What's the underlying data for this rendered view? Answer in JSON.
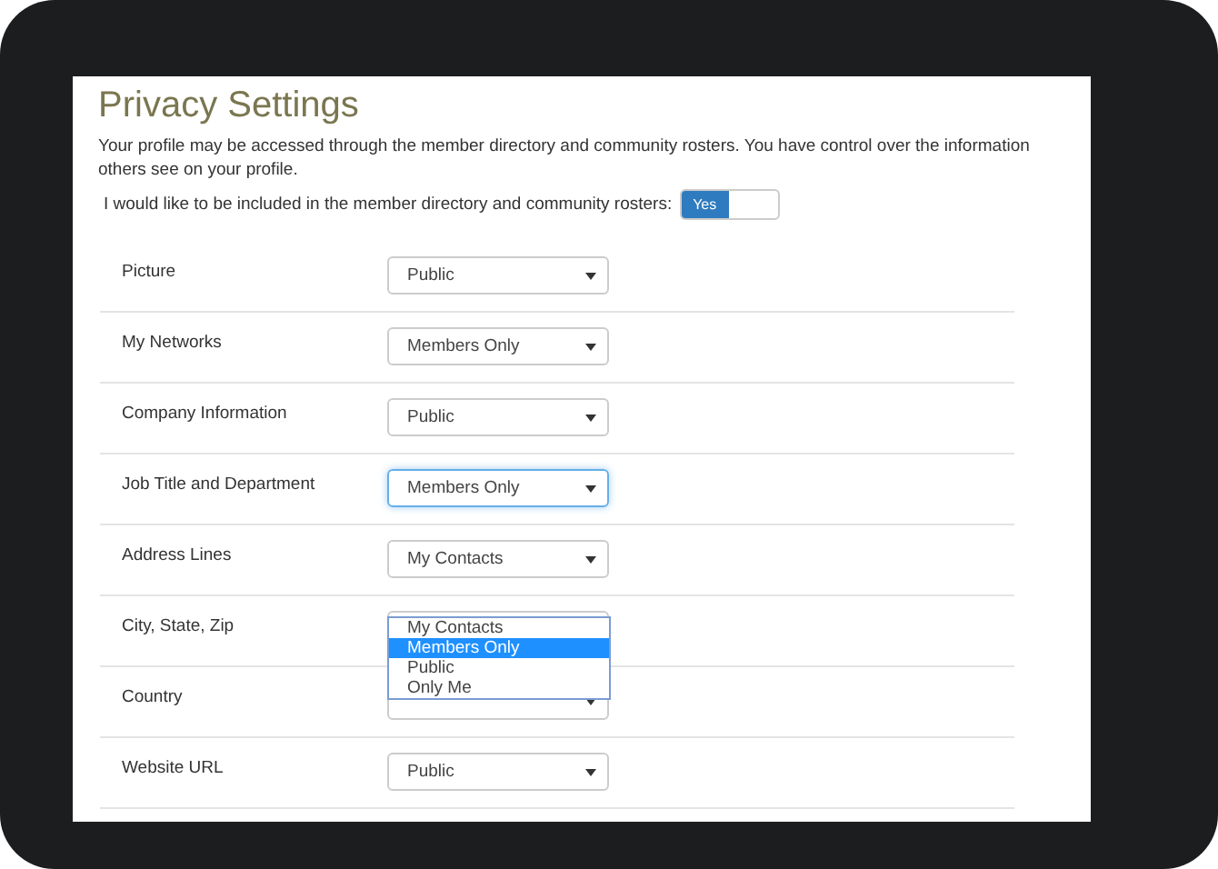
{
  "title": "Privacy Settings",
  "intro": "Your profile may be accessed through the member directory and community rosters. You have control over the information others see on your profile.",
  "directory_toggle": {
    "label": "I would like to be included in the member directory and community rosters:",
    "text": "Yes",
    "on": true
  },
  "settings": [
    {
      "label": "Picture",
      "value": "Public",
      "focused": false
    },
    {
      "label": "My Networks",
      "value": "Members Only",
      "focused": false
    },
    {
      "label": "Company Information",
      "value": "Public",
      "focused": false
    },
    {
      "label": "Job Title and Department",
      "value": "Members Only",
      "focused": true
    },
    {
      "label": "Address Lines",
      "value": "My Contacts",
      "focused": false
    },
    {
      "label": "City, State, Zip",
      "focused": false,
      "dropdown": [
        {
          "label": "My Contacts",
          "selected": false
        },
        {
          "label": "Members Only",
          "selected": true
        },
        {
          "label": "Public",
          "selected": false
        },
        {
          "label": "Only Me",
          "selected": false
        }
      ]
    },
    {
      "label": "Country",
      "focused": false
    },
    {
      "label": "Website URL",
      "value": "Public",
      "focused": false
    }
  ]
}
